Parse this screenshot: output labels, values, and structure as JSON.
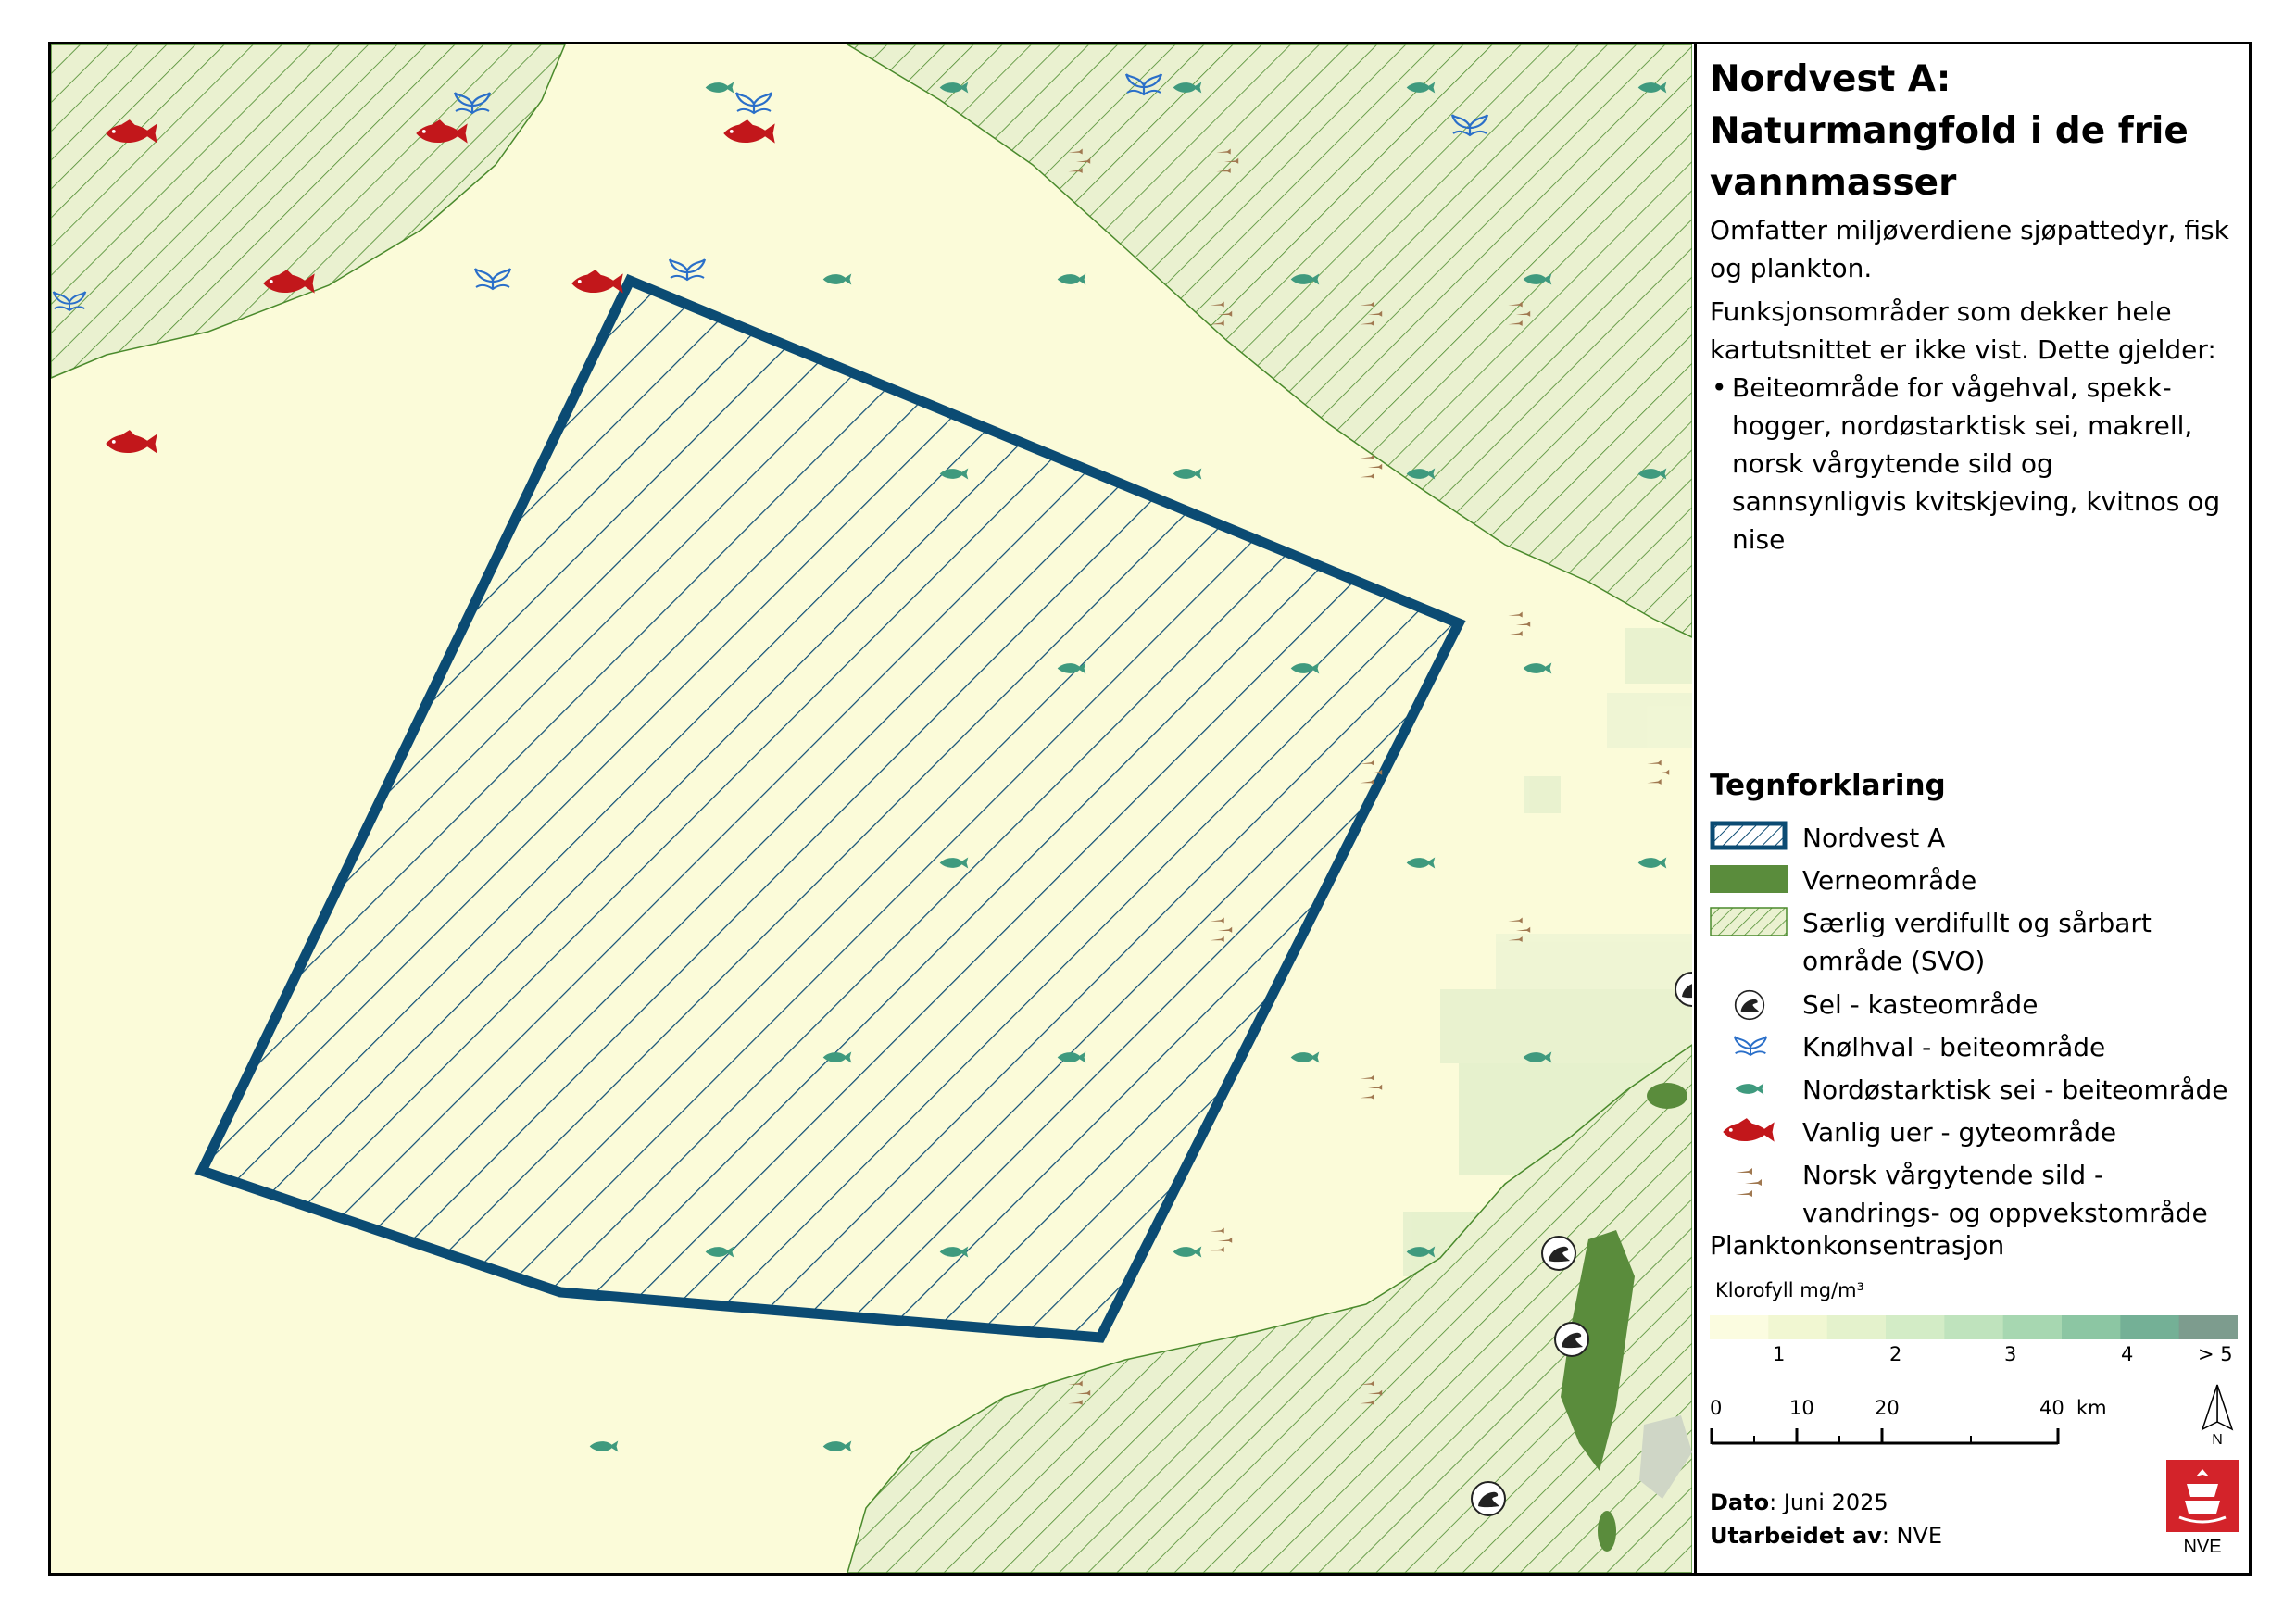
{
  "panel": {
    "title": "Nordvest A:\nNaturmangfold i de frie vannmasser",
    "title_line1": "Nordvest A:",
    "title_line2": "Naturmangfold i de frie",
    "title_line3": "vannmasser",
    "intro": "Omfatter miljøverdiene sjøpattedyr, fisk og plankton.",
    "note": "Funksjonsområder som dekker hele kartutsnittet er ikke vist. Dette gjelder:",
    "bullet": "Beiteområde for vågehval, spekk-hogger, nordøstarktisk sei, makrell, norsk vårgytende sild og sannsynligvis kvitskjeving, kvitnos og nise"
  },
  "legend": {
    "title": "Tegnforklaring",
    "items": [
      {
        "key": "nordvest-a",
        "label": "Nordvest A"
      },
      {
        "key": "verneomrade",
        "label": "Verneområde"
      },
      {
        "key": "svo",
        "label": "Særlig verdifullt og sårbart område (SVO)"
      },
      {
        "key": "sel",
        "label": "Sel - kasteområde",
        "icon": "seal-icon"
      },
      {
        "key": "knolhval",
        "label": "Knølhval - beiteområde",
        "icon": "whale-tail-icon"
      },
      {
        "key": "sei",
        "label": "Nordøstarktisk sei - beiteområde",
        "icon": "saithe-fish-icon"
      },
      {
        "key": "uer",
        "label": "Vanlig uer - gyteområde",
        "icon": "redfish-icon"
      },
      {
        "key": "sild",
        "label": "Norsk vårgytende sild - vandrings- og oppvekstområde",
        "icon": "herring-icon"
      }
    ],
    "plankton_title": "Planktonkonsentrasjon",
    "plankton_unit": "Klorofyll mg/m³",
    "plankton_ticks": [
      "1",
      "2",
      "3",
      "4",
      "> 5"
    ],
    "plankton_colors": [
      "#fbfce0",
      "#f1f7d2",
      "#e4f2cc",
      "#d3ecc6",
      "#bfe3bd",
      "#a7d7b1",
      "#8cc6a3",
      "#74b096",
      "#7d9c8e"
    ]
  },
  "scale": {
    "labels": [
      "0",
      "10",
      "20",
      "40"
    ],
    "unit": "km"
  },
  "north_label": "N",
  "footer": {
    "date_label": "Dato",
    "date_value": ": Juni 2025",
    "author_label": "Utarbeidet av",
    "author_value": ": NVE"
  },
  "logo_text": "NVE",
  "colors": {
    "sea": "#fbfbd9",
    "svo_fill": "#eaf1d0",
    "svo_hatch": "#4a8a2c",
    "nordvest": "#0b4b73",
    "protected": "#5a8c3c",
    "redfish": "#c2171b",
    "saithe": "#3f9a7e",
    "whale": "#2a6fc9",
    "herring": "#a07850"
  }
}
